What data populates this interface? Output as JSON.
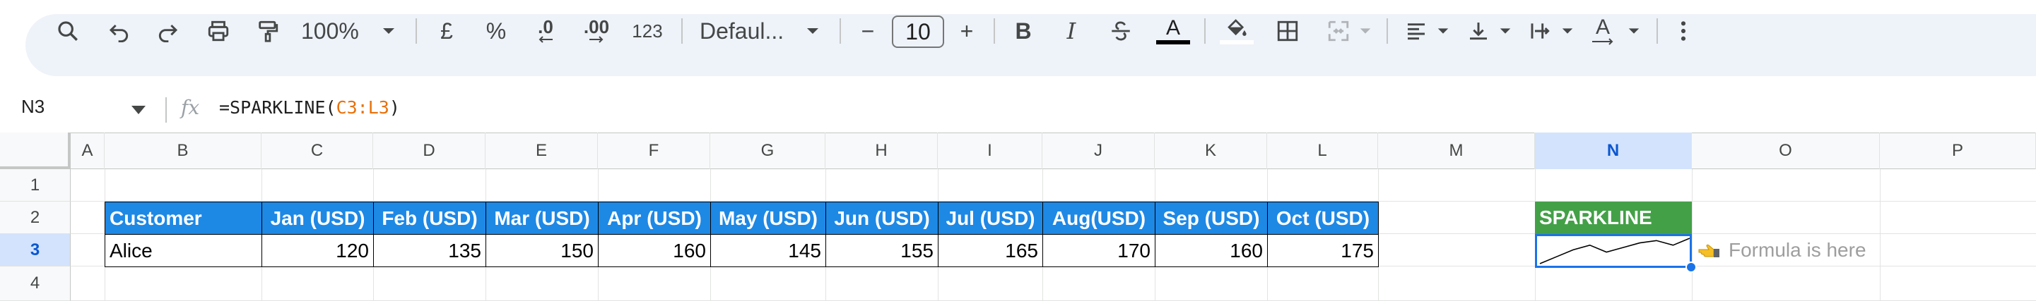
{
  "toolbar": {
    "zoom": "100%",
    "currency": "£",
    "percent": "%",
    "dec_decrease": ".0",
    "dec_increase": ".00",
    "number_format": "123",
    "font_name": "Defaul...",
    "font_size": "10",
    "minus": "−",
    "plus": "+",
    "bold": "B",
    "italic": "I",
    "text_color_letter": "A",
    "text_rotate_letter": "A"
  },
  "formula_bar": {
    "name_box": "N3",
    "fx": "fx",
    "formula_prefix": "=SPARKLINE(",
    "formula_ref": "C3:L3",
    "formula_suffix": ")"
  },
  "columns": [
    "A",
    "B",
    "C",
    "D",
    "E",
    "F",
    "G",
    "H",
    "I",
    "J",
    "K",
    "L",
    "M",
    "N",
    "O",
    "P"
  ],
  "rows": [
    "1",
    "2",
    "3",
    "4"
  ],
  "table": {
    "headers": [
      "Customer",
      "Jan (USD)",
      "Feb (USD)",
      "Mar (USD)",
      "Apr (USD)",
      "May (USD)",
      "Jun (USD)",
      "Jul (USD)",
      "Aug(USD)",
      "Sep (USD)",
      "Oct (USD)"
    ],
    "row": [
      "Alice",
      "120",
      "135",
      "150",
      "160",
      "145",
      "155",
      "165",
      "170",
      "160",
      "175"
    ]
  },
  "sparkline": {
    "header": "SPARKLINE",
    "values": [
      120,
      135,
      150,
      160,
      145,
      155,
      165,
      170,
      160,
      175
    ],
    "color": "#000000"
  },
  "note": {
    "icon": "pointing-hand-icon",
    "text": "Formula is here"
  },
  "colors": {
    "header_blue": "#1e88e5",
    "header_green": "#43a047",
    "selection": "#1a73e8"
  }
}
